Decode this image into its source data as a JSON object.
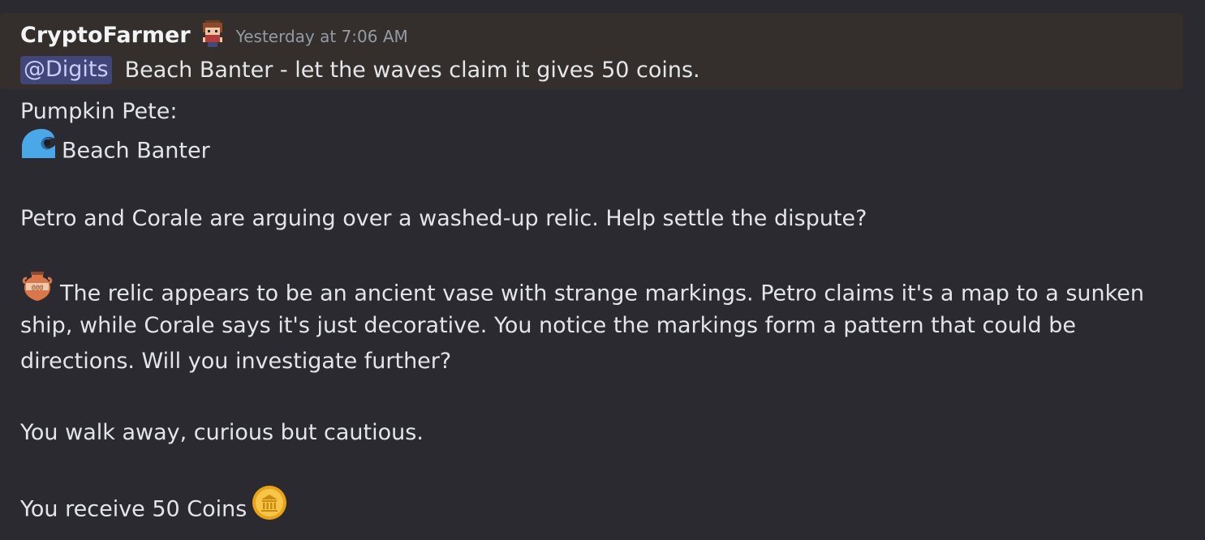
{
  "message": {
    "author": "CryptoFarmer",
    "timestamp": "Yesterday at 7:06 AM",
    "author_badge_icon": "pixel-farmer-avatar-icon",
    "reply": {
      "mention": "@Digits",
      "text": "Beach Banter - let the waves claim it gives 50 coins."
    },
    "lines": {
      "speaker": "Pumpkin Pete:",
      "event_title": "Beach Banter",
      "event_icon": "wave-icon",
      "intro": "Petro and Corale are arguing over a washed-up relic. Help settle the dispute?",
      "vase_icon": "amphora-icon",
      "story_1": "The relic appears to be an ancient vase with strange markings. Petro claims it's a map to a sunken",
      "story_2": "ship, while Corale says it's just decorative. You notice the markings form a pattern that could be",
      "story_3": "directions. Will you investigate further?",
      "outcome": "You walk away, curious but cautious.",
      "reward": "You receive 50 Coins",
      "coin_icon": "coin-icon"
    }
  },
  "colors": {
    "background": "#2b2a30",
    "highlight": "#342f2d",
    "mention_bg": "#414577",
    "mention_text": "#c9cdfb",
    "timestamp": "#959aa3"
  }
}
